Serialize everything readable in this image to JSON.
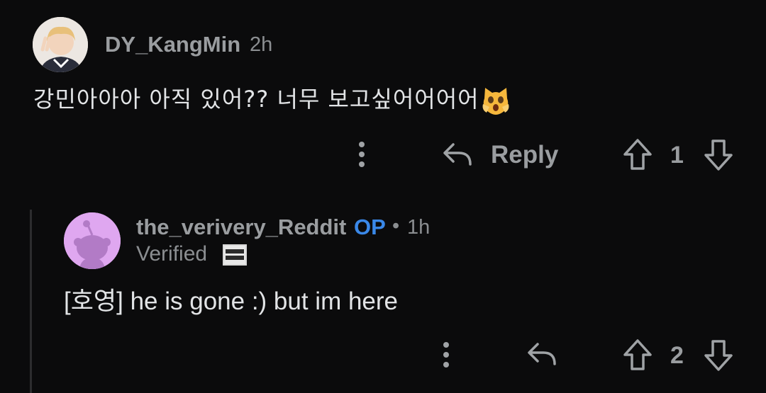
{
  "comment1": {
    "username": "DY_KangMin",
    "time": "2h",
    "body": "강민아아아 아직 있어?? 너무 보고싶어어어어",
    "emoji": "screaming-cat-emoji",
    "reply_label": "Reply",
    "votes": "1"
  },
  "comment2": {
    "username": "the_verivery_Reddit",
    "op_badge": "OP",
    "separator": "•",
    "time": "1h",
    "flair": "Verified",
    "flair_badge_text": "VERI VERY",
    "body": "[호영] he is gone :) but im here",
    "votes": "2"
  },
  "colors": {
    "background": "#0b0b0c",
    "text_primary": "#e2e4e6",
    "text_muted": "#9a9da0",
    "op_blue": "#3a88e8",
    "snoo_avatar_bg": "#dfa7f0"
  }
}
